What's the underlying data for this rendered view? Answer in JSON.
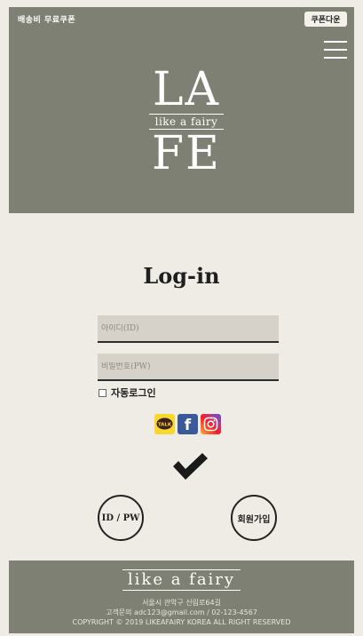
{
  "header": {
    "promo_text": "배송비 무료쿠폰",
    "coupon_button": "쿠폰다운",
    "menu_icon": "hamburger-icon",
    "logo_top": "LA",
    "logo_middle": "like a fairy",
    "logo_bottom": "FE"
  },
  "login": {
    "title": "Log-in",
    "id_placeholder": "아이디(ID)",
    "pw_placeholder": "비밀번호(PW)",
    "auto_login_label": "자동로그인",
    "social": [
      {
        "name": "kakao-talk-icon",
        "label": "TALK",
        "color": "#f8d82a"
      },
      {
        "name": "facebook-icon",
        "label": "f",
        "color": "#3b5998"
      },
      {
        "name": "instagram-icon",
        "label": "",
        "color": "#c13584"
      }
    ],
    "submit_icon": "checkmark-icon",
    "find_button": "ID / PW",
    "join_button": "회원가입"
  },
  "footer": {
    "logo": "like a fairy",
    "address": "서울시 관악구 신림로64길",
    "contact": "고객문의 adc123@gmail.com / 02-123-4567",
    "copyright": "COPYRIGHT © 2019 LIKEAFAIRY KOREA ALL RIGHT RESERVED"
  },
  "colors": {
    "header_bg": "#7d8072",
    "page_bg": "#efebe5",
    "field_bg": "#d6d1c9",
    "accent": "#222222"
  }
}
